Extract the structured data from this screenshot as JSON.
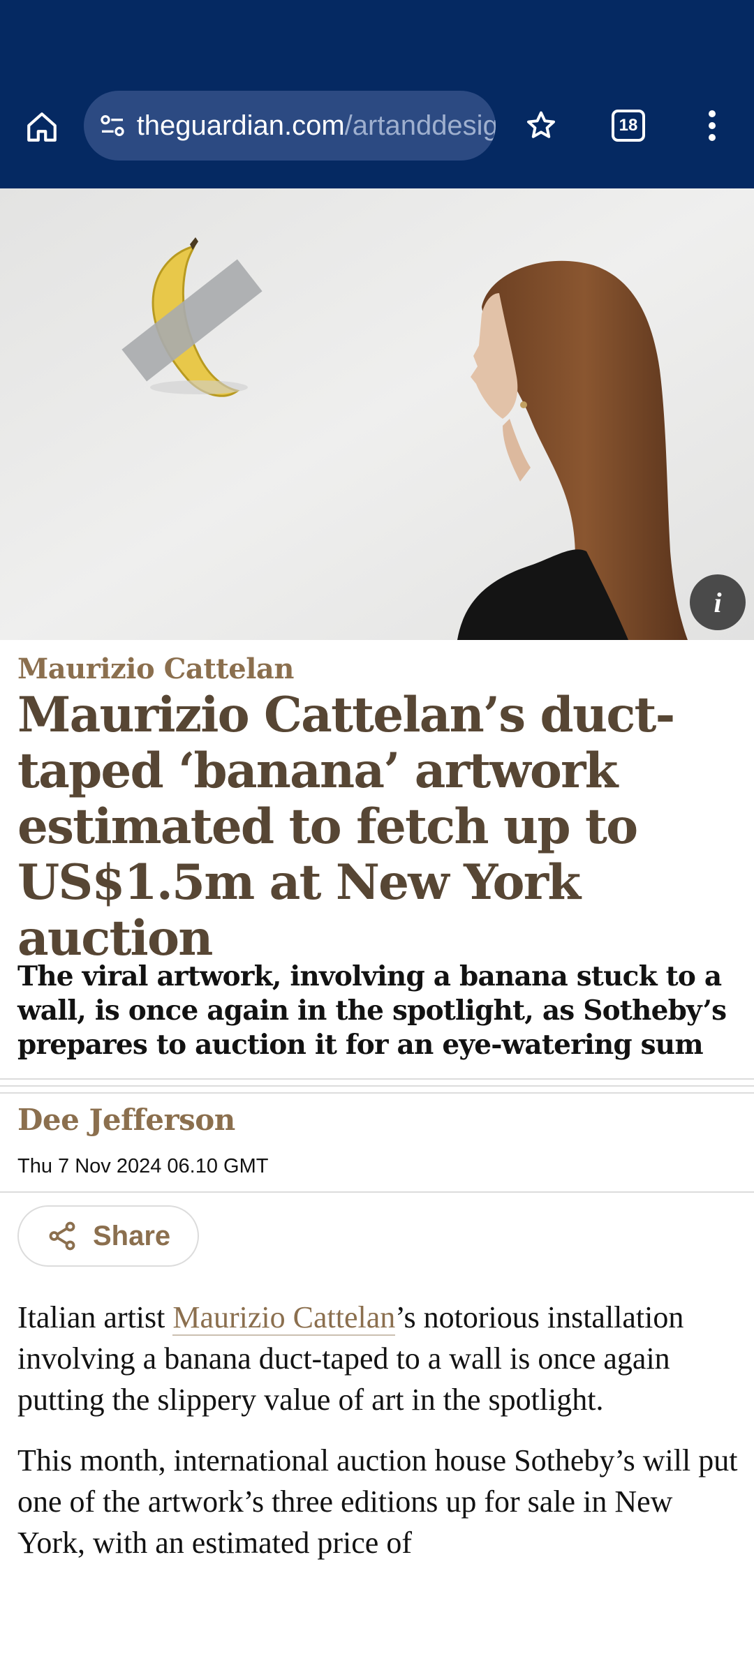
{
  "browser": {
    "url_domain": "theguardian.com",
    "url_path": "/artanddesign",
    "tab_count": "18",
    "icons": [
      "home-icon",
      "site-info-icon",
      "star-icon",
      "tabs-icon",
      "more-vert-icon"
    ],
    "toolbar_color": "#052962"
  },
  "article": {
    "kicker": "Maurizio Cattelan",
    "headline": "Maurizio Cattelan’s duct-taped ‘banana’ artwork estimated to fetch up to US$1.5m at New York auction",
    "standfirst": "The viral artwork, involving a banana stuck to a wall, is once again in the spotlight, as Sotheby’s prepares to auction it for an eye-watering sum",
    "author": "Dee Jefferson",
    "date": "Thu 7 Nov 2024 06.10 GMT",
    "share_label": "Share",
    "image_info_label": "i",
    "body": {
      "p1_before": "Italian artist ",
      "p1_link": "Maurizio Cattelan",
      "p1_after": "’s notorious installation involving a banana duct-taped to a wall is once again putting the slippery value of art in the spotlight.",
      "p2": "This month, international auction house Sotheby’s will put one of the artwork’s three editions up for sale in New York, with an estimated price of"
    },
    "accent_color": "#8b6f4e",
    "headline_color": "#574634"
  }
}
